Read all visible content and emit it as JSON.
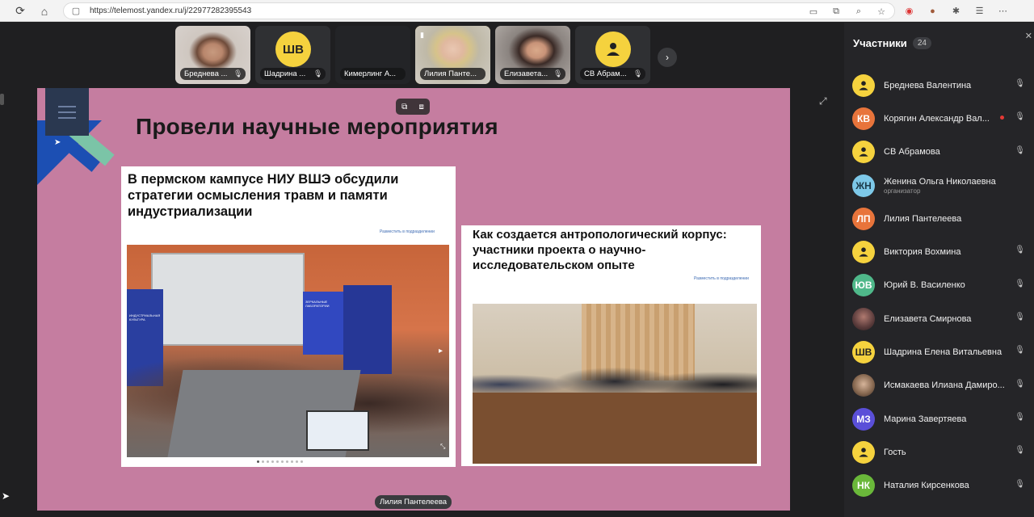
{
  "browser": {
    "url": "https://telemost.yandex.ru/j/22977282395543"
  },
  "thumbnails": [
    {
      "name": "Бреднева ...",
      "type": "video",
      "muted": true
    },
    {
      "name": "Шадрина ...",
      "initials": "ШВ",
      "type": "avatar",
      "muted": true
    },
    {
      "name": "Кимерлинг А...",
      "type": "dark",
      "muted": false
    },
    {
      "name": "Лилия Панте...",
      "type": "video",
      "active": true,
      "muted": false
    },
    {
      "name": "Елизавета...",
      "type": "video",
      "muted": true
    },
    {
      "name": "СВ Абрам...",
      "type": "avatar-person",
      "muted": true
    }
  ],
  "slide": {
    "title": "Провели научные мероприятия",
    "card1_title": "В пермском кампусе НИУ ВШЭ обсудили стратегии осмысления травм и памяти индустриализации",
    "card2_title": "Как создается антропологический корпус: участники проекта о научно-исследовательском опыте",
    "share_link": "Разместить в подразделении",
    "screen_text_1": "ИНДУСТРИАЛЬНАЯ КУЛЬТУРА",
    "screen_text_2": "ЗЕРКАЛЬНЫЕ ЛАБОРАТОРИИ"
  },
  "speaker_chip": "Лилия Пантелеева",
  "sidebar": {
    "title": "Участники",
    "count": "24",
    "participants": [
      {
        "name": "Бреднева Валентина",
        "avatar": "person",
        "color": "#f5d23e",
        "muted": true
      },
      {
        "name": "Корягин Александр Вал...",
        "initials": "КВ",
        "color": "#e8743b",
        "muted": true,
        "recording": true
      },
      {
        "name": "СВ Абрамова",
        "avatar": "person",
        "color": "#f5d23e",
        "muted": true
      },
      {
        "name": "Женина Ольга Николаевна",
        "initials": "ЖН",
        "color": "#7dc8e8",
        "role": "организатор",
        "muted": false
      },
      {
        "name": "Лилия Пантелеева",
        "initials": "ЛП",
        "color": "#e8743b",
        "muted": false
      },
      {
        "name": "Виктория Вохмина",
        "avatar": "person",
        "color": "#f5d23e",
        "muted": true
      },
      {
        "name": "Юрий В. Василенко",
        "initials": "ЮВ",
        "color": "#4fb88a",
        "muted": true
      },
      {
        "name": "Елизавета Смирнова",
        "avatar": "photo",
        "color": "#5a3b3b",
        "muted": true
      },
      {
        "name": "Шадрина Елена Витальевна",
        "initials": "ШВ",
        "color": "#f5d23e",
        "muted": true
      },
      {
        "name": "Исмакаева Илиана Дамиро...",
        "avatar": "photo",
        "color": "#6b5a48",
        "muted": true
      },
      {
        "name": "Марина Завертяева",
        "initials": "МЗ",
        "color": "#5a4fd8",
        "muted": true
      },
      {
        "name": "Гость",
        "avatar": "person",
        "color": "#f5d23e",
        "muted": true
      },
      {
        "name": "Наталия Кирсенкова",
        "initials": "НК",
        "color": "#6ab83a",
        "muted": true
      }
    ]
  }
}
